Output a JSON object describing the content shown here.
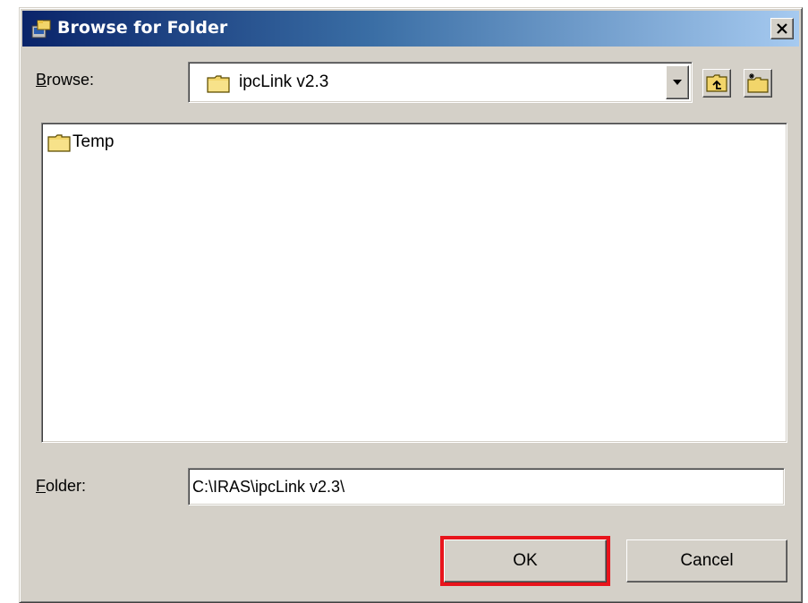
{
  "window": {
    "title": "Browse for Folder",
    "app_icon": "browse-folder-icon",
    "close_label": "×"
  },
  "browse": {
    "label_prefix": "B",
    "label_rest": "rowse:",
    "current_folder": "ipcLink v2.3",
    "folder_icon": "folder-icon",
    "dropdown_icon": "chevron-down-icon",
    "up_button_icon": "folder-up-icon",
    "new_folder_button_icon": "new-folder-icon"
  },
  "list": {
    "items": [
      {
        "label": "Temp",
        "icon": "folder-icon"
      }
    ]
  },
  "folder": {
    "label_prefix": "F",
    "label_rest": "older:",
    "value": "C:\\IRAS\\ipcLink v2.3\\"
  },
  "buttons": {
    "ok": "OK",
    "cancel": "Cancel"
  },
  "colors": {
    "dialog_face": "#d4d0c8",
    "title_gradient_start": "#0a246a",
    "title_gradient_end": "#a6caf0",
    "folder_yellow": "#f2d56a",
    "highlight_red": "#e8141c"
  }
}
